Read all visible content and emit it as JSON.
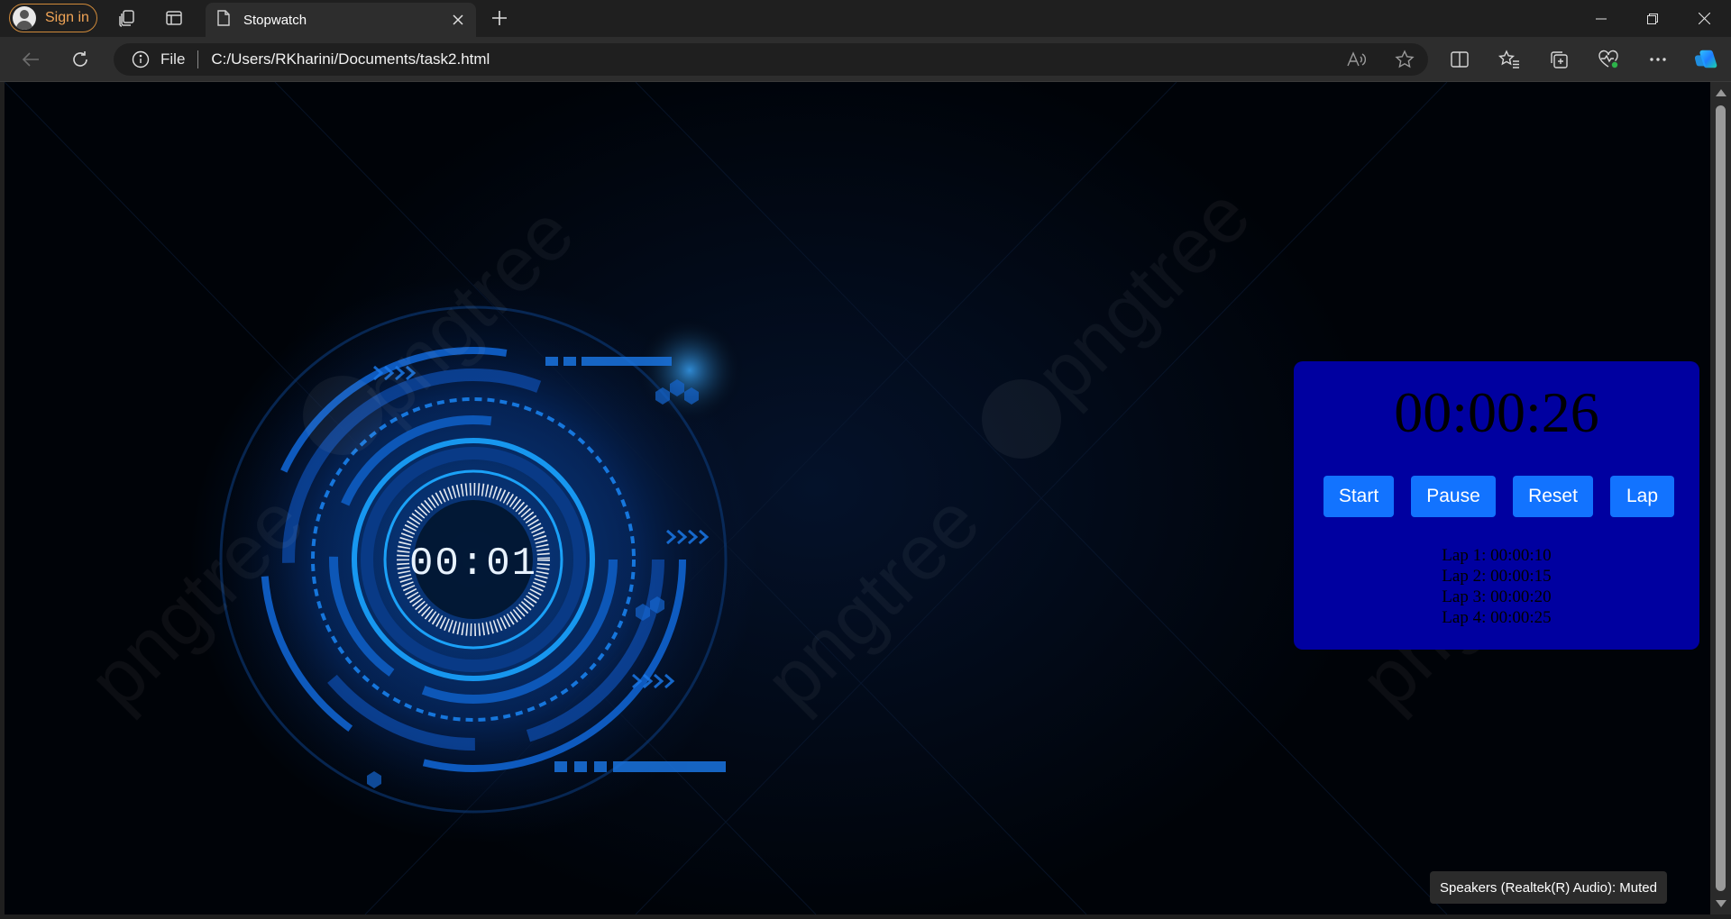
{
  "browser": {
    "signin_label": "Sign in",
    "tab_title": "Stopwatch",
    "address_scheme": "File",
    "address_url": "C:/Users/RKharini/Documents/task2.html"
  },
  "stopwatch": {
    "display": "00:00:26",
    "buttons": {
      "start": "Start",
      "pause": "Pause",
      "reset": "Reset",
      "lap": "Lap"
    },
    "laps": [
      "Lap 1: 00:00:10",
      "Lap 2: 00:00:15",
      "Lap 3: 00:00:20",
      "Lap 4: 00:00:25"
    ]
  },
  "background": {
    "clock_readout": "00:01",
    "watermark": "pngtree"
  },
  "toast": {
    "text": "Speakers (Realtek(R) Audio): Muted"
  },
  "colors": {
    "card_bg": "#0000a0",
    "button_bg": "#1273ff",
    "glow": "#1a8cff"
  }
}
